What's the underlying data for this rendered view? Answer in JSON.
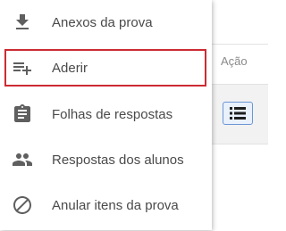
{
  "table": {
    "column_header": "Ação",
    "row_action_icon": "list-icon"
  },
  "menu": {
    "items": [
      {
        "label": "Anexos da prova",
        "icon": "download-icon"
      },
      {
        "label": "Aderir",
        "icon": "playlist-add-icon",
        "selected": true
      },
      {
        "label": "Folhas de respostas",
        "icon": "assignment-icon"
      },
      {
        "label": "Respostas dos alunos",
        "icon": "people-icon"
      },
      {
        "label": "Anular itens da prova",
        "icon": "block-icon"
      }
    ]
  },
  "colors": {
    "icon": "#5f5f5f",
    "label": "#4a4a4a",
    "highlight": "#cc2b33",
    "button_border": "#6b95d4"
  }
}
